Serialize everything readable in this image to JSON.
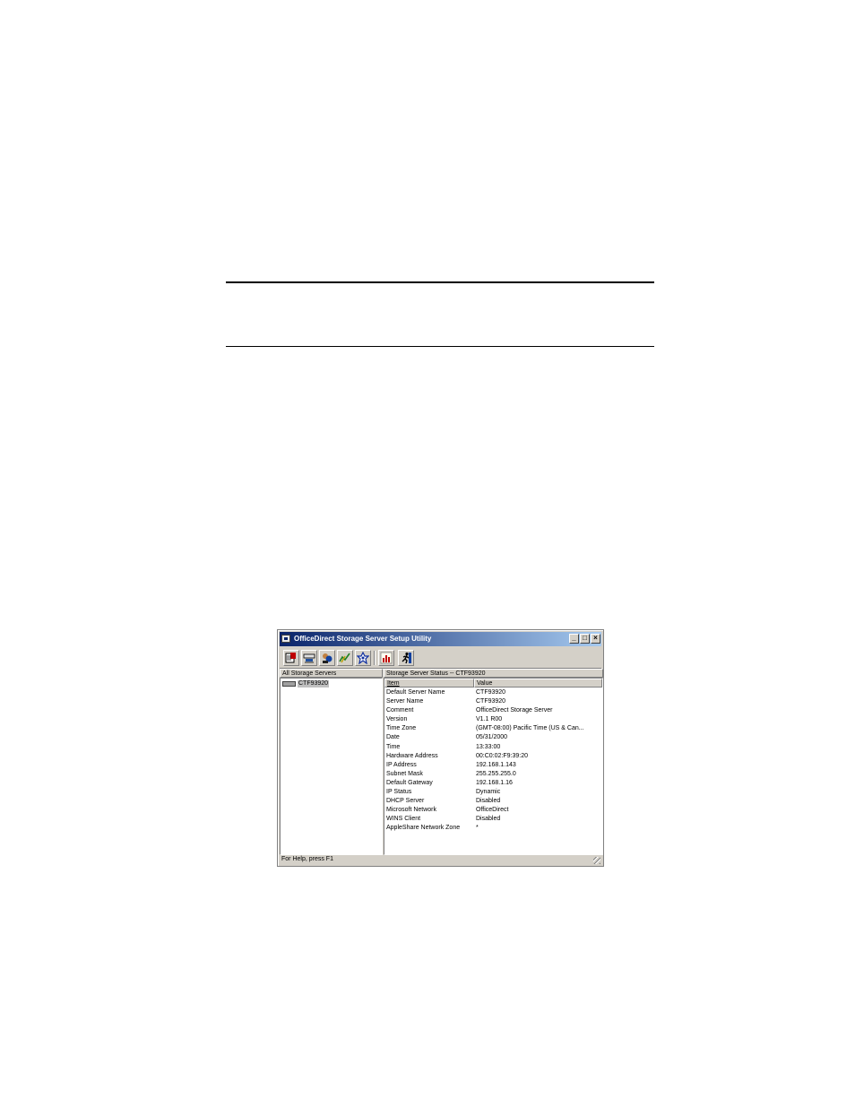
{
  "window": {
    "title": "OfficeDirect Storage Server Setup Utility",
    "controls": {
      "minimize": "_",
      "maximize": "□",
      "close": "×"
    }
  },
  "toolbar": {
    "buttons": [
      {
        "icon": "properties-icon"
      },
      {
        "icon": "network-icon"
      },
      {
        "icon": "users-icon"
      },
      {
        "icon": "signal-icon"
      },
      {
        "icon": "star-icon"
      },
      {
        "icon": "chart-icon"
      },
      {
        "icon": "exit-icon"
      }
    ]
  },
  "left_pane": {
    "header": "All Storage Servers",
    "servers": [
      "CTF93920"
    ]
  },
  "right_pane": {
    "header": "Storage Server Status -- CTF93920",
    "columns": {
      "item": "Item",
      "value": "Value"
    },
    "rows": [
      {
        "item": "Default Server Name",
        "value": "CTF93920"
      },
      {
        "item": "Server Name",
        "value": "CTF93920"
      },
      {
        "item": "Comment",
        "value": "OfficeDirect Storage Server"
      },
      {
        "item": "Version",
        "value": "V1.1 R00"
      },
      {
        "item": "Time Zone",
        "value": "(GMT-08:00) Pacific Time (US & Can..."
      },
      {
        "item": "Date",
        "value": "05/31/2000"
      },
      {
        "item": "Time",
        "value": "13:33:00"
      },
      {
        "item": "Hardware Address",
        "value": "00:C0:02:F9:39:20"
      },
      {
        "item": "IP Address",
        "value": "192.168.1.143"
      },
      {
        "item": "Subnet Mask",
        "value": "255.255.255.0"
      },
      {
        "item": "Default Gateway",
        "value": "192.168.1.16"
      },
      {
        "item": "IP Status",
        "value": "Dynamic"
      },
      {
        "item": "DHCP Server",
        "value": "Disabled"
      },
      {
        "item": "Microsoft Network",
        "value": "OfficeDirect"
      },
      {
        "item": "WINS Client",
        "value": "Disabled"
      },
      {
        "item": "AppleShare Network Zone",
        "value": "*"
      }
    ]
  },
  "status_bar": {
    "text": "For Help, press F1"
  },
  "colors": {
    "titlebar_start": "#0a246a",
    "titlebar_end": "#a6caf0",
    "face": "#d4d0c8"
  }
}
